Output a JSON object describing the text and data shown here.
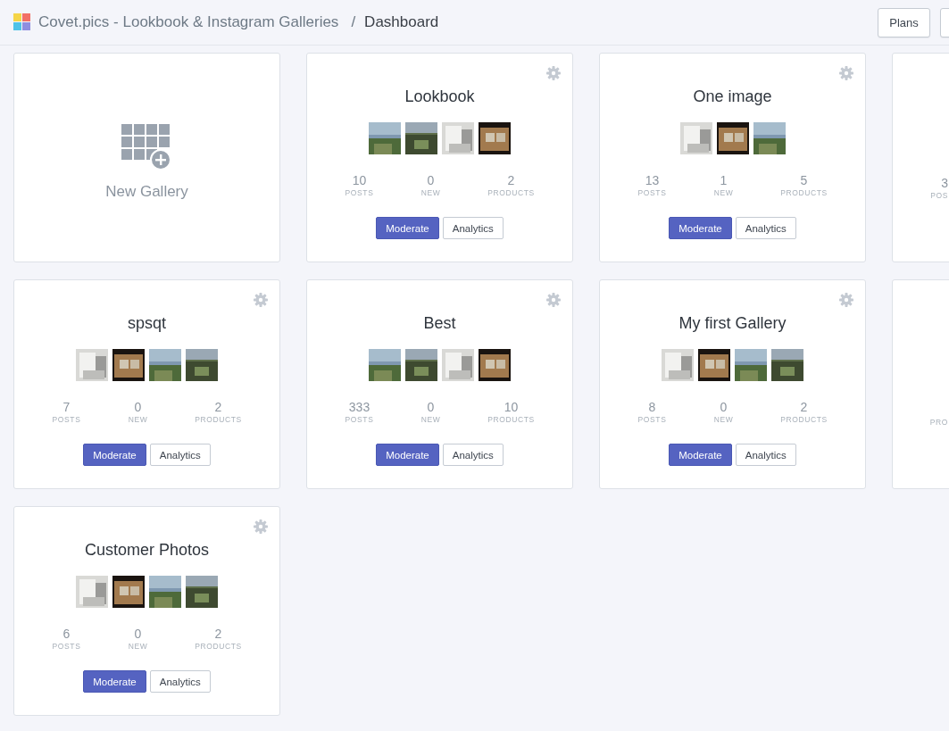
{
  "header": {
    "app_title": "Covet.pics - Lookbook & Instagram Galleries",
    "separator": "/",
    "page_title": "Dashboard",
    "buttons": [
      "Plans"
    ]
  },
  "cards": [
    {
      "kind": "new",
      "label": "New Gallery"
    },
    {
      "kind": "gallery",
      "title": "Lookbook",
      "thumbnails": [
        {
          "kind": "picture"
        },
        {
          "kind": "picture"
        },
        {
          "kind": "picture"
        },
        {
          "kind": "picture"
        }
      ],
      "stats": [
        {
          "value": "10",
          "label": "POSTS"
        },
        {
          "value": "0",
          "label": "NEW"
        },
        {
          "value": "2",
          "label": "PRODUCTS"
        }
      ],
      "buttons": [
        {
          "label": "Moderate",
          "kind": "primary"
        },
        {
          "label": "Analytics",
          "kind": "secondary"
        }
      ]
    },
    {
      "kind": "gallery",
      "title": "One image",
      "thumbnails": [
        {
          "kind": "picture"
        },
        {
          "kind": "picture"
        },
        {
          "kind": "picture"
        }
      ],
      "stats": [
        {
          "value": "13",
          "label": "POSTS"
        },
        {
          "value": "1",
          "label": "NEW"
        },
        {
          "value": "5",
          "label": "PRODUCTS"
        }
      ],
      "buttons": [
        {
          "label": "Moderate",
          "kind": "primary"
        },
        {
          "label": "Analytics",
          "kind": "secondary"
        }
      ]
    },
    {
      "kind": "partial",
      "stats": [
        {
          "value": "3",
          "label": "POS"
        }
      ]
    },
    {
      "kind": "gallery",
      "title": "spsqt",
      "thumbnails": [
        {
          "kind": "picture"
        },
        {
          "kind": "picture"
        },
        {
          "kind": "picture"
        },
        {
          "kind": "picture"
        }
      ],
      "stats": [
        {
          "value": "7",
          "label": "POSTS"
        },
        {
          "value": "0",
          "label": "NEW"
        },
        {
          "value": "2",
          "label": "PRODUCTS"
        }
      ],
      "buttons": [
        {
          "label": "Moderate",
          "kind": "primary"
        },
        {
          "label": "Analytics",
          "kind": "secondary"
        }
      ]
    },
    {
      "kind": "gallery",
      "title": "Best",
      "thumbnails": [
        {
          "kind": "picture"
        },
        {
          "kind": "picture"
        },
        {
          "kind": "picture"
        },
        {
          "kind": "picture"
        }
      ],
      "stats": [
        {
          "value": "333",
          "label": "POSTS"
        },
        {
          "value": "0",
          "label": "NEW"
        },
        {
          "value": "10",
          "label": "PRODUCTS"
        }
      ],
      "buttons": [
        {
          "label": "Moderate",
          "kind": "primary"
        },
        {
          "label": "Analytics",
          "kind": "secondary"
        }
      ]
    },
    {
      "kind": "gallery",
      "title": "My first Gallery",
      "thumbnails": [
        {
          "kind": "picture"
        },
        {
          "kind": "picture"
        },
        {
          "kind": "picture"
        },
        {
          "kind": "picture"
        }
      ],
      "stats": [
        {
          "value": "8",
          "label": "POSTS"
        },
        {
          "value": "0",
          "label": "NEW"
        },
        {
          "value": "2",
          "label": "PRODUCTS"
        }
      ],
      "buttons": [
        {
          "label": "Moderate",
          "kind": "primary"
        },
        {
          "label": "Analytics",
          "kind": "secondary"
        }
      ]
    },
    {
      "kind": "partial",
      "stats": [
        {
          "label": "PRO"
        }
      ]
    },
    {
      "kind": "gallery",
      "title": "Customer Photos",
      "thumbnails": [
        {
          "kind": "picture"
        },
        {
          "kind": "picture"
        },
        {
          "kind": "picture"
        },
        {
          "kind": "picture"
        }
      ],
      "stats": [
        {
          "value": "6",
          "label": "POSTS"
        },
        {
          "value": "0",
          "label": "NEW"
        },
        {
          "value": "2",
          "label": "PRODUCTS"
        }
      ],
      "buttons": [
        {
          "label": "Moderate",
          "kind": "primary"
        },
        {
          "label": "Analytics",
          "kind": "secondary"
        }
      ]
    }
  ]
}
